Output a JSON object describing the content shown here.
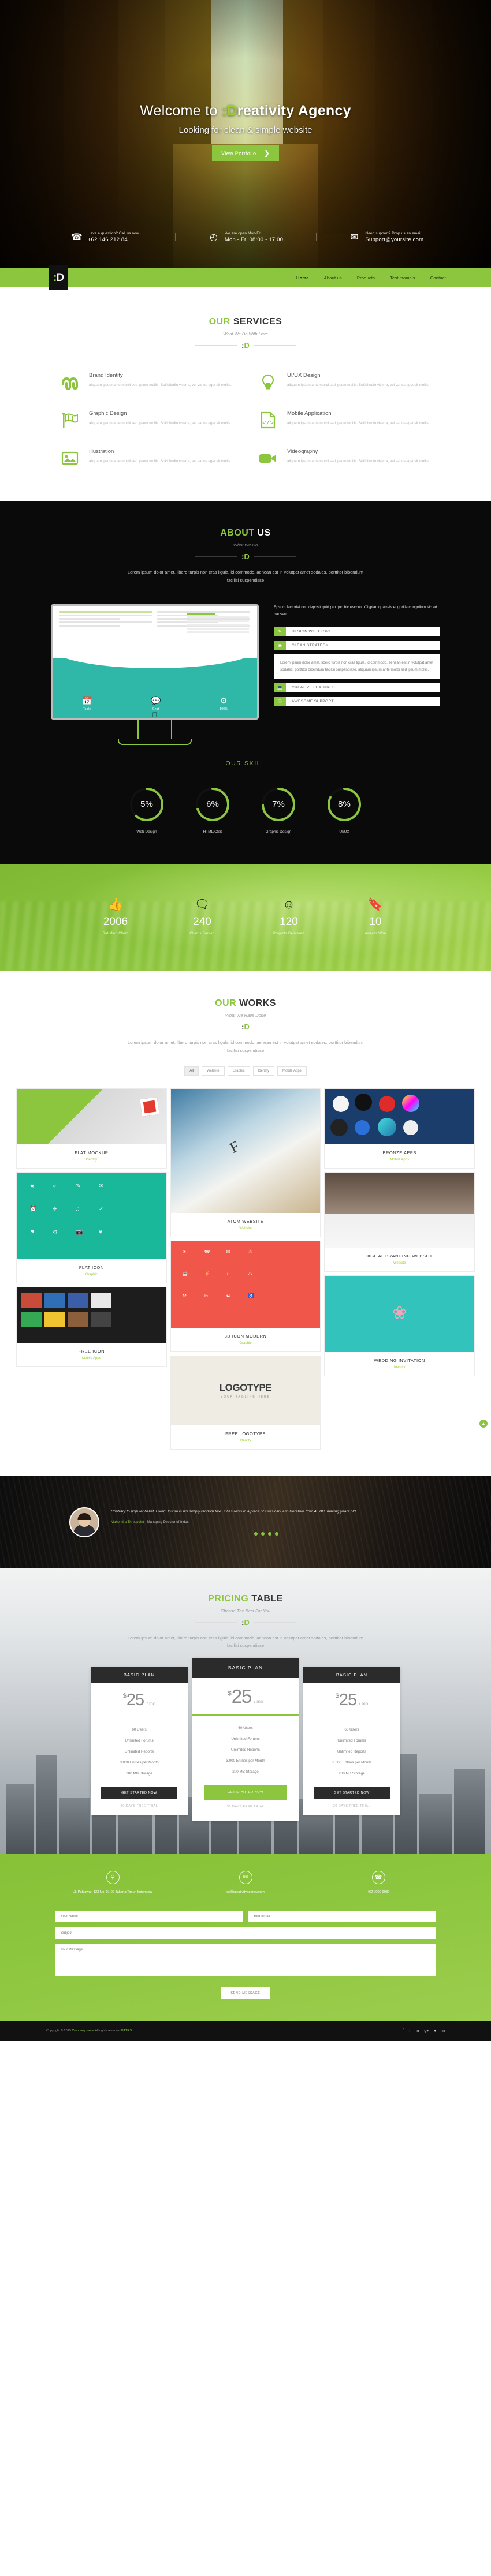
{
  "hero": {
    "title_pre": "Welcome to ",
    "title_mark": ":D",
    "title_rest": "reativity Agency",
    "subtitle": "Looking for clean & simple website",
    "button": "View Portfolio",
    "chevron": "❯",
    "contacts": [
      {
        "icon": "phone-icon",
        "glyph": "☎",
        "top": "Have a question? Call us now",
        "main": "+62 146 212 84"
      },
      {
        "icon": "clock-icon",
        "glyph": "◴",
        "top": "We are open Mon-Fri",
        "main": "Mon - Fri 08:00 - 17:00"
      },
      {
        "icon": "mail-icon",
        "glyph": "✉",
        "top": "Need support? Drop us an email",
        "main": "Support@yoursite.com"
      }
    ]
  },
  "nav": {
    "logo_dots": ":",
    "logo_letter": "D",
    "links": [
      {
        "label": "Home",
        "active": true
      },
      {
        "label": "About us",
        "active": false
      },
      {
        "label": "Products",
        "active": false
      },
      {
        "label": "Testimonials",
        "active": false
      },
      {
        "label": "Contact",
        "active": false
      }
    ]
  },
  "services": {
    "title_green": "OUR ",
    "title_dark": "SERVICES",
    "subtitle": "What We Do With Love",
    "items": [
      {
        "icon": "stumbleupon-icon",
        "glyph": "⑂",
        "title": "Brand Identity",
        "desc": "aliquam ipsum ante morbi sed ipsum mollis. Sollicitudin viverra, vel varius eget sit mollis."
      },
      {
        "icon": "lightbulb-icon",
        "glyph": "Ὂ1",
        "title": "UI/UX Design",
        "desc": "aliquam ipsum ante morbi sed ipsum mollis. Sollicitudin viverra, vel varius eget sit mollis."
      },
      {
        "icon": "flag-icon",
        "glyph": "⚑",
        "title": "Graphic Design",
        "desc": "aliquam ipsum ante morbi sed ipsum mollis. Sollicitudin viverra, vel varius eget sit mollis."
      },
      {
        "icon": "code-file-icon",
        "glyph": "‹›",
        "title": "Mobile Application",
        "desc": "aliquam ipsum ante morbi sed ipsum mollis. Sollicitudin viverra, vel varius eget sit mollis."
      },
      {
        "icon": "image-icon",
        "glyph": "ὛC",
        "title": "Illustration",
        "desc": "aliquam ipsum ante morbi sed ipsum mollis. Sollicitudin viverra, vel varius eget sit mollis."
      },
      {
        "icon": "video-camera-icon",
        "glyph": "Ἲ5",
        "title": "Videography",
        "desc": "aliquam ipsum ante morbi sed ipsum mollis. Sollicitudin viverra, vel varius eget sit mollis."
      }
    ]
  },
  "about": {
    "title_green": "ABOUT ",
    "title_light": "US",
    "subtitle": "What We Do",
    "lead": "Lorem ipsum dolor amet, libero turpis non cras ligula, id commodo, aenean est in volutpat amet sodales, porttitor bibendum facilisi suspendisse",
    "monitor": {
      "labels": [
        "Table",
        "Chat",
        "100%"
      ],
      "glyphs": [
        "Ὄ5",
        "ὊC",
        "⚙"
      ]
    },
    "accordion_lead": "Epsum factorial non deposit quid pro quo hic escorol. Olyplan quarrels et gorilla congolium sic ad nauseum.",
    "accordion": [
      {
        "icon": "pencil-icon",
        "glyph": "✎",
        "label": "DESIGN WITH LOVE",
        "open": false
      },
      {
        "icon": "lifebuoy-icon",
        "glyph": "☉",
        "label": "CLEAN STRATEGY",
        "open": true,
        "panel": "Lorem ipsum dolor amet, libero turpis non cras ligula, id commodo, aenean est in volutpat amet sodales, porttitor bibendum facilisi suspendisse, aliquam ipsum ante morbi sed ipsum mollis."
      },
      {
        "icon": "laptop-icon",
        "glyph": "ὋB",
        "label": "CREATIVE FEATURES",
        "open": false
      },
      {
        "icon": "support-icon",
        "glyph": "★",
        "label": "AWESOME SUPPORT",
        "open": false
      }
    ]
  },
  "skills": {
    "title": "OUR SKILL",
    "items": [
      {
        "value": "5%",
        "pct": 62,
        "name": "Web Design"
      },
      {
        "value": "6%",
        "pct": 70,
        "name": "HTML/CSS"
      },
      {
        "value": "7%",
        "pct": 74,
        "name": "Graphic Design"
      },
      {
        "value": "8%",
        "pct": 82,
        "name": "UI/UX"
      }
    ]
  },
  "counters": [
    {
      "icon": "thumbs-up-icon",
      "glyph": "ὄD",
      "value": "2006",
      "label": "Satisfied Client"
    },
    {
      "icon": "chat-bubbles-icon",
      "glyph": "὞9",
      "value": "240",
      "label": "Clients Served"
    },
    {
      "icon": "smiley-icon",
      "glyph": "☺",
      "value": "120",
      "label": "Projects Delivered"
    },
    {
      "icon": "bookmark-icon",
      "glyph": "ὑ6",
      "value": "10",
      "label": "Awards Won"
    }
  ],
  "works": {
    "title_green": "OUR ",
    "title_dark": "WORKS",
    "subtitle": "What We Have Done",
    "lead": "Lorem ipsum dolor amet, libero turpis non cras ligula, id commodo, aenean est in volutpat amet sodales, porttitor bibendum facilisi suspendisse",
    "filters": [
      {
        "label": "All",
        "active": true
      },
      {
        "label": "Website",
        "active": false
      },
      {
        "label": "Graphic",
        "active": false
      },
      {
        "label": "Identity",
        "active": false
      },
      {
        "label": "Mobile Apps",
        "active": false
      }
    ],
    "items": [
      {
        "title": "FLAT MOCKUP",
        "category": "Identity",
        "theme": "th-mock"
      },
      {
        "title": "ATOM WEBSITE",
        "category": "Website",
        "theme": "th-atom"
      },
      {
        "title": "BRONZE APPS",
        "category": "Mobile Apps",
        "theme": "th-bronze"
      },
      {
        "title": "FLAT ICON",
        "category": "Graphic",
        "theme": "th-flat"
      },
      {
        "title": "3D ICON MODERN",
        "category": "Graphic",
        "theme": "th-icon"
      },
      {
        "title": "DIGITAL BRANDING WEBSITE",
        "category": "Website",
        "theme": "th-digi"
      },
      {
        "title": "FREE ICON",
        "category": "Mobile Apps",
        "theme": "th-free"
      },
      {
        "title": "FREE LOGOTYPE",
        "category": "Identity",
        "theme": "th-logo"
      },
      {
        "title": "WEDDING INVITATION",
        "category": "Identity",
        "theme": "th-wed"
      }
    ]
  },
  "testimonial": {
    "quote": "Contrary to popular belief, Lorem Ipsum is not simply random text. It has roots in a piece of classical Latin literature from 45 BC, making years old",
    "author": "Mahendra Threepoint",
    "role": " - Managing Director of Indox",
    "dots": [
      true,
      true,
      true,
      true
    ]
  },
  "pricing": {
    "title_green": "PRICING ",
    "title_dark": "TABLE",
    "subtitle": "Choose The Best For You",
    "lead": "Lorem ipsum dolor amet, libero turpis non cras ligula, id commodo, aenean est in volutpat amet sodales, porttitor bibendum facilisi suspendisse",
    "plans": [
      {
        "name": "BASIC PLAN",
        "currency": "$",
        "amount": "25",
        "period": "/ mo",
        "features": [
          "60 Users",
          "Unlimited Forums",
          "Unlimited Reports",
          "3.000 Entries per Month",
          "200 MB Storage"
        ],
        "cta": "GET STARTED NOW",
        "trial": "30 DAYS FREE TRIAL",
        "featured": false
      },
      {
        "name": "BASIC PLAN",
        "currency": "$",
        "amount": "25",
        "period": "/ mo",
        "features": [
          "60 Users",
          "Unlimited Forums",
          "Unlimited Reports",
          "3.000 Entries per Month",
          "200 MB Storage"
        ],
        "cta": "GET STARTED NOW",
        "trial": "30 DAYS FREE TRIAL",
        "featured": true
      },
      {
        "name": "BASIC PLAN",
        "currency": "$",
        "amount": "25",
        "period": "/ mo",
        "features": [
          "60 Users",
          "Unlimited Forums",
          "Unlimited Reports",
          "3.000 Entries per Month",
          "200 MB Storage"
        ],
        "cta": "GET STARTED NOW",
        "trial": "30 DAYS FREE TRIAL",
        "featured": false
      }
    ]
  },
  "contact": {
    "boxes": [
      {
        "icon": "location-pin-icon",
        "glyph": "⚑",
        "text": "Jl. Pahlawan 123 No. 01 02\nJakarta Timur, Indonesia"
      },
      {
        "icon": "envelope-icon",
        "glyph": "✉",
        "text": "cs@dreativityagency.com"
      },
      {
        "icon": "phone-icon",
        "glyph": "☎",
        "text": "+62 0090 9080"
      }
    ],
    "fields": {
      "name_placeholder": "Your Name",
      "email_placeholder": "Your Email",
      "subject_placeholder": "Subject",
      "message_placeholder": "Your Message"
    },
    "send_label": "SEND MESSAGE"
  },
  "footer": {
    "copyright_pre": "Copyright © 2015 ",
    "copyright_brand": "Company name",
    "copyright_post": " All rights reserved ",
    "copyright_brand2": "BTTRS",
    "social": [
      {
        "icon": "facebook-icon",
        "glyph": "f"
      },
      {
        "icon": "twitter-icon",
        "glyph": "ᴛ"
      },
      {
        "icon": "linkedin-icon",
        "glyph": "in"
      },
      {
        "icon": "google-plus-icon",
        "glyph": "g+"
      },
      {
        "icon": "dribbble-icon",
        "glyph": "●"
      },
      {
        "icon": "linkedin2-icon",
        "glyph": "in"
      }
    ]
  },
  "colors": {
    "accent": "#8CC63E",
    "dark": "#0a0a0a",
    "muted": "#9a9a9a"
  }
}
